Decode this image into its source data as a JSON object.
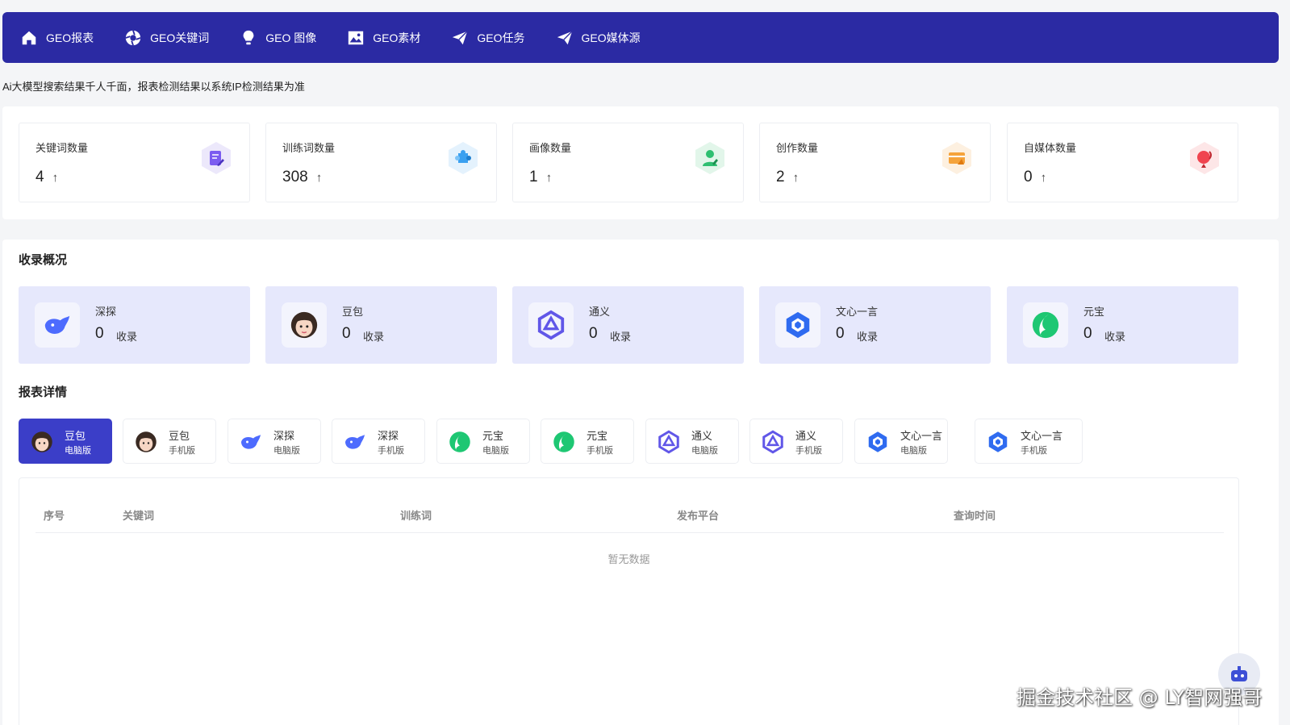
{
  "nav": {
    "items": [
      {
        "label": "GEO报表",
        "icon": "home-icon"
      },
      {
        "label": "GEO关键词",
        "icon": "aperture-icon"
      },
      {
        "label": "GEO 图像",
        "icon": "lightbulb-icon"
      },
      {
        "label": "GEO素材",
        "icon": "image-icon"
      },
      {
        "label": "GEO任务",
        "icon": "send-icon"
      },
      {
        "label": "GEO媒体源",
        "icon": "send-icon"
      }
    ]
  },
  "notice": "Ai大模型搜索结果千人千面，报表检测结果以系统IP检测结果为准",
  "stats": [
    {
      "label": "关键词数量",
      "value": "4",
      "arrow": "↑",
      "icon": "document-edit-icon",
      "color": "#7b5cf0"
    },
    {
      "label": "训练词数量",
      "value": "308",
      "arrow": "↑",
      "icon": "puzzle-icon",
      "color": "#3aa0f0"
    },
    {
      "label": "画像数量",
      "value": "1",
      "arrow": "↑",
      "icon": "user-portrait-icon",
      "color": "#2fbf71"
    },
    {
      "label": "创作数量",
      "value": "2",
      "arrow": "↑",
      "icon": "creation-icon",
      "color": "#f5a33b"
    },
    {
      "label": "自媒体数量",
      "value": "0",
      "arrow": "↑",
      "icon": "broadcast-icon",
      "color": "#f0444f"
    }
  ],
  "overview": {
    "title": "收录概况",
    "unit": "收录",
    "items": [
      {
        "name": "深探",
        "count": "0",
        "icon": "deepseek-whale-icon"
      },
      {
        "name": "豆包",
        "count": "0",
        "icon": "doubao-avatar-icon"
      },
      {
        "name": "通义",
        "count": "0",
        "icon": "tongyi-star-icon"
      },
      {
        "name": "文心一言",
        "count": "0",
        "icon": "wenxin-hex-icon"
      },
      {
        "name": "元宝",
        "count": "0",
        "icon": "yuanbao-leaf-icon"
      }
    ]
  },
  "details": {
    "title": "报表详情",
    "tabs": [
      {
        "name": "豆包",
        "sub": "电脑版",
        "icon": "doubao-avatar-icon",
        "active": true
      },
      {
        "name": "豆包",
        "sub": "手机版",
        "icon": "doubao-avatar-icon",
        "active": false
      },
      {
        "name": "深探",
        "sub": "电脑版",
        "icon": "deepseek-whale-icon",
        "active": false
      },
      {
        "name": "深探",
        "sub": "手机版",
        "icon": "deepseek-whale-icon",
        "active": false
      },
      {
        "name": "元宝",
        "sub": "电脑版",
        "icon": "yuanbao-leaf-icon",
        "active": false
      },
      {
        "name": "元宝",
        "sub": "手机版",
        "icon": "yuanbao-leaf-icon",
        "active": false
      },
      {
        "name": "通义",
        "sub": "电脑版",
        "icon": "tongyi-star-icon",
        "active": false
      },
      {
        "name": "通义",
        "sub": "手机版",
        "icon": "tongyi-star-icon",
        "active": false
      },
      {
        "name": "文心一言",
        "sub": "电脑版",
        "icon": "wenxin-hex-icon",
        "active": false
      },
      {
        "name": "文心一言",
        "sub": "手机版",
        "icon": "wenxin-hex-icon",
        "active": false
      }
    ],
    "columns": [
      "序号",
      "关键词",
      "训练词",
      "发布平台",
      "查询时间"
    ],
    "empty_text": "暂无数据"
  },
  "watermark": "掘金技术社区 @ LY智网强哥",
  "colors": {
    "nav_bg": "#2b2aa3",
    "accent": "#3b3ec8",
    "card_bg": "#e6e8fc"
  }
}
